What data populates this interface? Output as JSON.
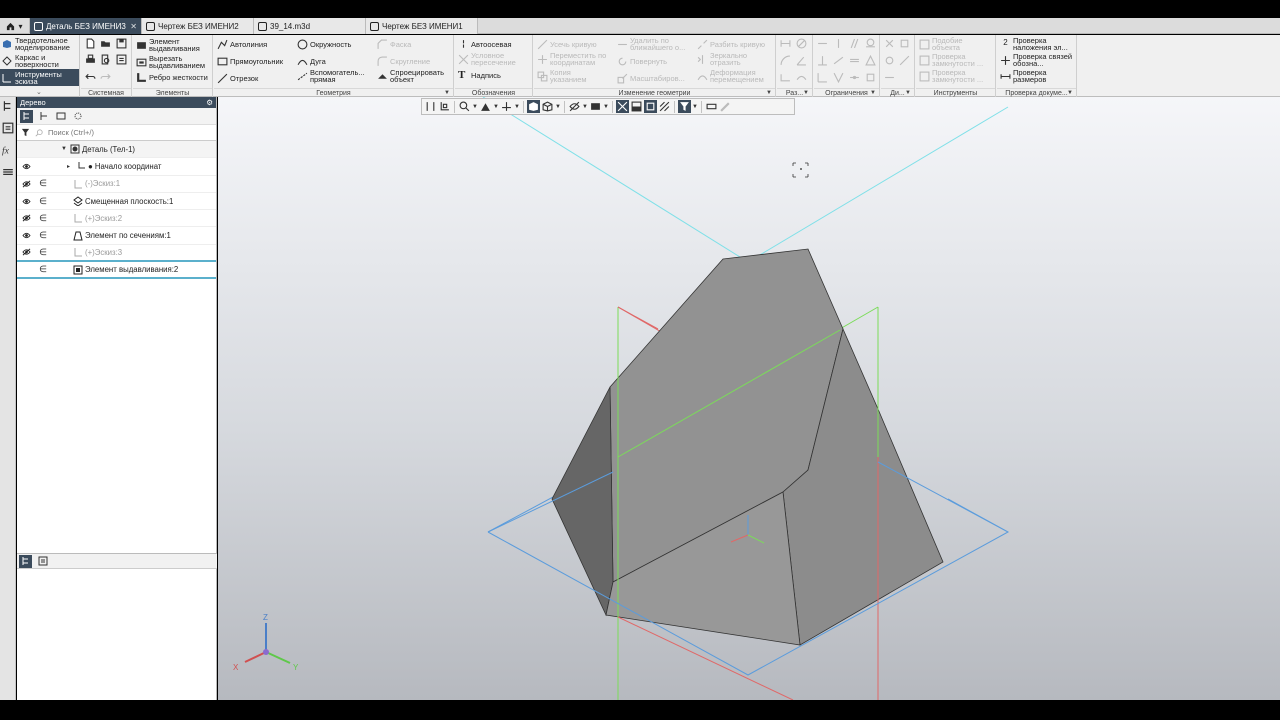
{
  "tabs": [
    {
      "label": "Деталь БЕЗ ИМЕНИ3",
      "active": true
    },
    {
      "label": "Чертеж БЕЗ ИМЕНИ2",
      "active": false
    },
    {
      "label": "39_14.m3d",
      "active": false
    },
    {
      "label": "Чертеж БЕЗ ИМЕНИ1",
      "active": false
    }
  ],
  "modes": [
    "Твердотельное моделирование",
    "Каркас и поверхности",
    "Инструменты эскиза"
  ],
  "ribbon": {
    "groups": {
      "system": "Системная",
      "elements": "Элементы",
      "geometry": "Геометрия",
      "designations": "Обозначения",
      "edit_geometry": "Изменение геометрии",
      "dimensions": "Раз...",
      "constraints": "Ограничения",
      "di": "Ди...",
      "tools": "Инструменты",
      "doc_check": "Проверка докуме..."
    },
    "elements": {
      "extrude": "Элемент выдавливания",
      "cut_extrude": "Вырезать выдавливанием",
      "rib": "Ребро жесткости"
    },
    "geometry": {
      "autoline": "Автолиния",
      "rectangle": "Прямоугольник",
      "segment": "Отрезок",
      "circle": "Окружность",
      "arc": "Дуга",
      "aux_line": "Вспомогатель... прямая",
      "chamfer": "Фаска",
      "fillet": "Скругление",
      "project": "Спроецировать объект"
    },
    "designations": {
      "axis": "Автоосевая",
      "cond_intersection": "Условное пересечение",
      "text": "Надпись"
    },
    "edit_geometry": {
      "trim": "Усечь кривую",
      "delete_nearest": "Удалить по ближайшего о...",
      "split": "Разбить кривую",
      "move_coords": "Переместить по координатам",
      "rotate": "Повернуть",
      "mirror": "Зеркально отразить",
      "copy_pointer": "Копия указанием",
      "scale": "Масштабиров...",
      "deform": "Деформация перемещением"
    },
    "tools": {
      "similar": "Подобие объекта",
      "closure1": "Проверка замкнутости ...",
      "closure2": "Проверка замкнутости ..."
    },
    "checks": {
      "overlap": "Проверка наложения эл...",
      "links": "Проверка связей обозна...",
      "sizes": "Проверка размеров"
    }
  },
  "tree": {
    "title": "Дерево",
    "search_placeholder": "Поиск (Ctrl+/)",
    "root": "Деталь (Тел-1)",
    "nodes": [
      {
        "label": "Начало координат",
        "eye": true,
        "dim": false
      },
      {
        "label": "(-)Эскиз:1",
        "eye": "off",
        "dim": true
      },
      {
        "label": "Смещенная плоскость:1",
        "eye": true,
        "dim": false
      },
      {
        "label": "(+)Эскиз:2",
        "eye": "off",
        "dim": true
      },
      {
        "label": "Элемент по сечениям:1",
        "eye": true,
        "dim": false
      },
      {
        "label": "(+)Эскиз:3",
        "eye": "off",
        "dim": true
      },
      {
        "label": "Элемент выдавливания:2",
        "eye": false,
        "dim": false
      }
    ]
  },
  "axis_labels": {
    "x": "X",
    "y": "Y",
    "z": "Z"
  },
  "colors": {
    "active_tab": "#3b4b5c",
    "plane_red": "#e06868",
    "plane_green": "#7bdc59",
    "plane_blue": "#5b9cdc",
    "plane_cyan": "#7fe0e8",
    "body_light": "#929292",
    "body_dark": "#6a6a6a",
    "body_side": "#8a8a8a"
  }
}
